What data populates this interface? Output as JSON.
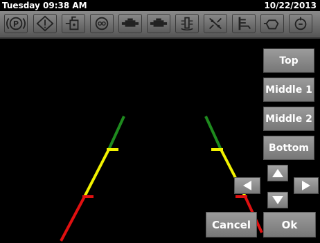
{
  "status": {
    "time": "Tuesday 09:38 AM",
    "date": "10/22/2013"
  },
  "telltales": [
    "parking-brake-icon",
    "warning-icon",
    "oil-pressure-icon",
    "brake-system-icon",
    "engine-icon",
    "engine-icon",
    "coolant-icon",
    "fuel-filter-icon",
    "fuel-level-icon",
    "transmission-icon",
    "transmission-temp-icon"
  ],
  "buttons": {
    "top": "Top",
    "middle1": "Middle 1",
    "middle2": "Middle 2",
    "bottom": "Bottom",
    "cancel": "Cancel",
    "ok": "Ok"
  },
  "guide_colors": {
    "far": "#1e8a1e",
    "mid": "#f2f200",
    "near": "#e01010"
  }
}
